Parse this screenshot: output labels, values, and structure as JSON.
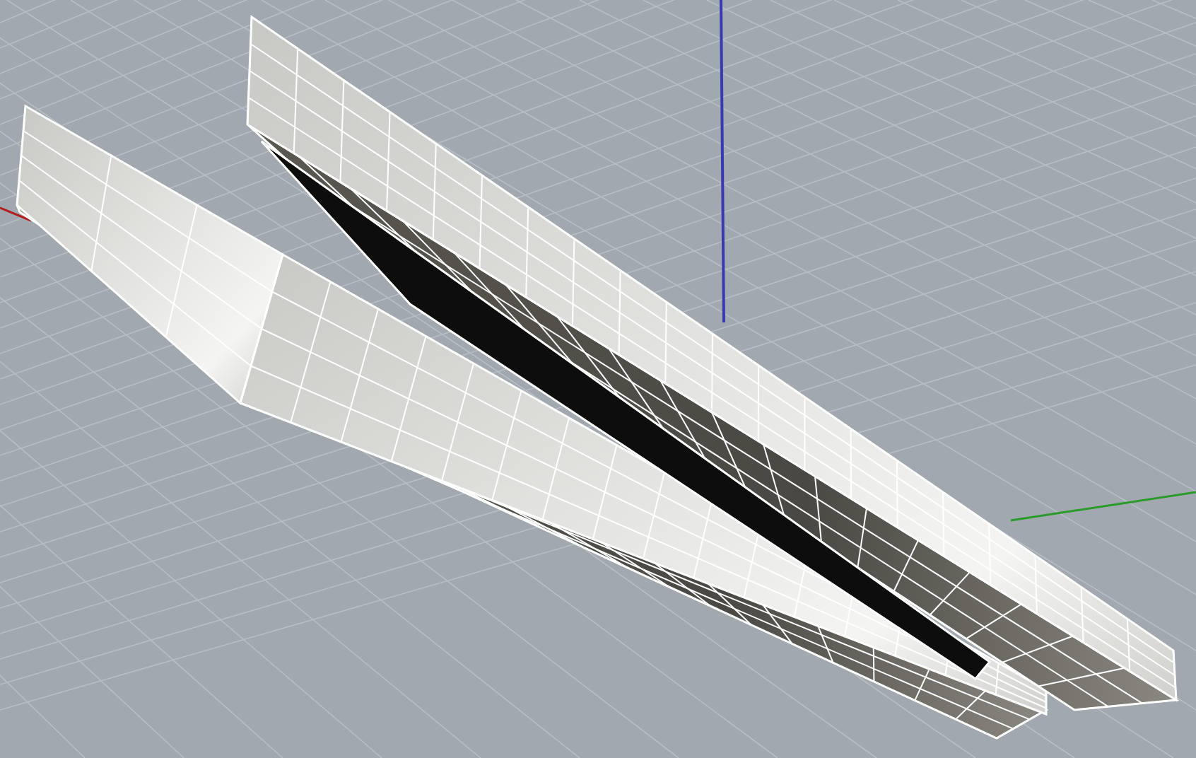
{
  "viewport": {
    "show_grid": true,
    "show_axes": true,
    "show_wireframe": true
  }
}
